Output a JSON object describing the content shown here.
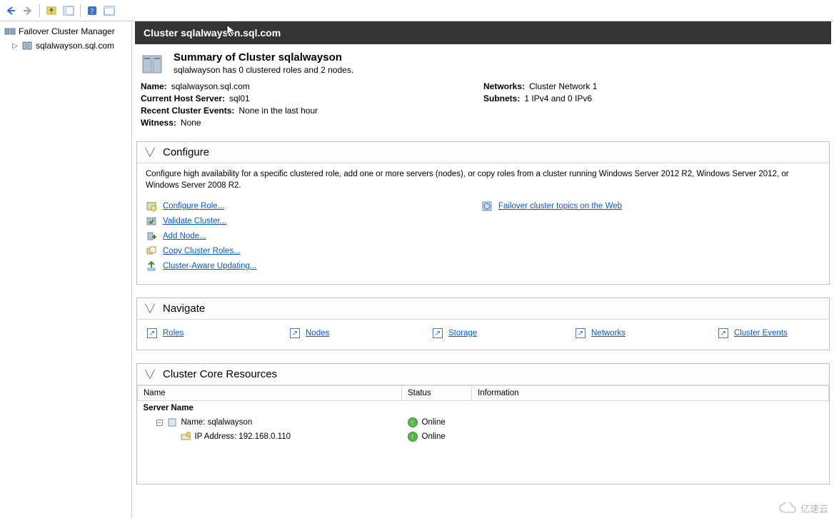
{
  "tree": {
    "root_label": "Failover Cluster Manager",
    "child_label": "sqlalwayson.sql.com"
  },
  "header": {
    "title": "Cluster sqlalwayson.sql.com"
  },
  "summary": {
    "title": "Summary of Cluster sqlalwayson",
    "subtitle": "sqlalwayson has 0 clustered roles and 2 nodes."
  },
  "props_left": {
    "name_label": "Name:",
    "name_value": "sqlalwayson.sql.com",
    "host_label": "Current Host Server:",
    "host_value": "sql01",
    "events_label": "Recent Cluster Events:",
    "events_value": "None in the last hour",
    "witness_label": "Witness:",
    "witness_value": "None"
  },
  "props_right": {
    "networks_label": "Networks:",
    "networks_value": "Cluster Network 1",
    "subnets_label": "Subnets:",
    "subnets_value": "1 IPv4 and 0 IPv6"
  },
  "configure": {
    "title": "Configure",
    "instructions": "Configure high availability for a specific clustered role, add one or more servers (nodes), or copy roles from a cluster running Windows Server 2012 R2, Windows Server 2012, or Windows Server 2008 R2.",
    "links": {
      "configure_role": "Configure Role...",
      "validate_cluster": "Validate Cluster...",
      "add_node": "Add Node...",
      "copy_roles": "Copy Cluster Roles...",
      "cau": "Cluster-Aware Updating...",
      "web_topics": "Failover cluster topics on the Web"
    }
  },
  "navigate": {
    "title": "Navigate",
    "items": {
      "roles": "Roles",
      "nodes": "Nodes",
      "storage": "Storage",
      "networks": "Networks",
      "events": "Cluster Events"
    }
  },
  "core_resources": {
    "title": "Cluster Core Resources",
    "columns": {
      "name": "Name",
      "status": "Status",
      "info": "Information"
    },
    "group_label": "Server Name",
    "rows": [
      {
        "name": "Name: sqlalwayson",
        "status": "Online"
      },
      {
        "name": "IP Address: 192.168.0.110",
        "status": "Online"
      }
    ]
  },
  "watermark": "亿速云"
}
